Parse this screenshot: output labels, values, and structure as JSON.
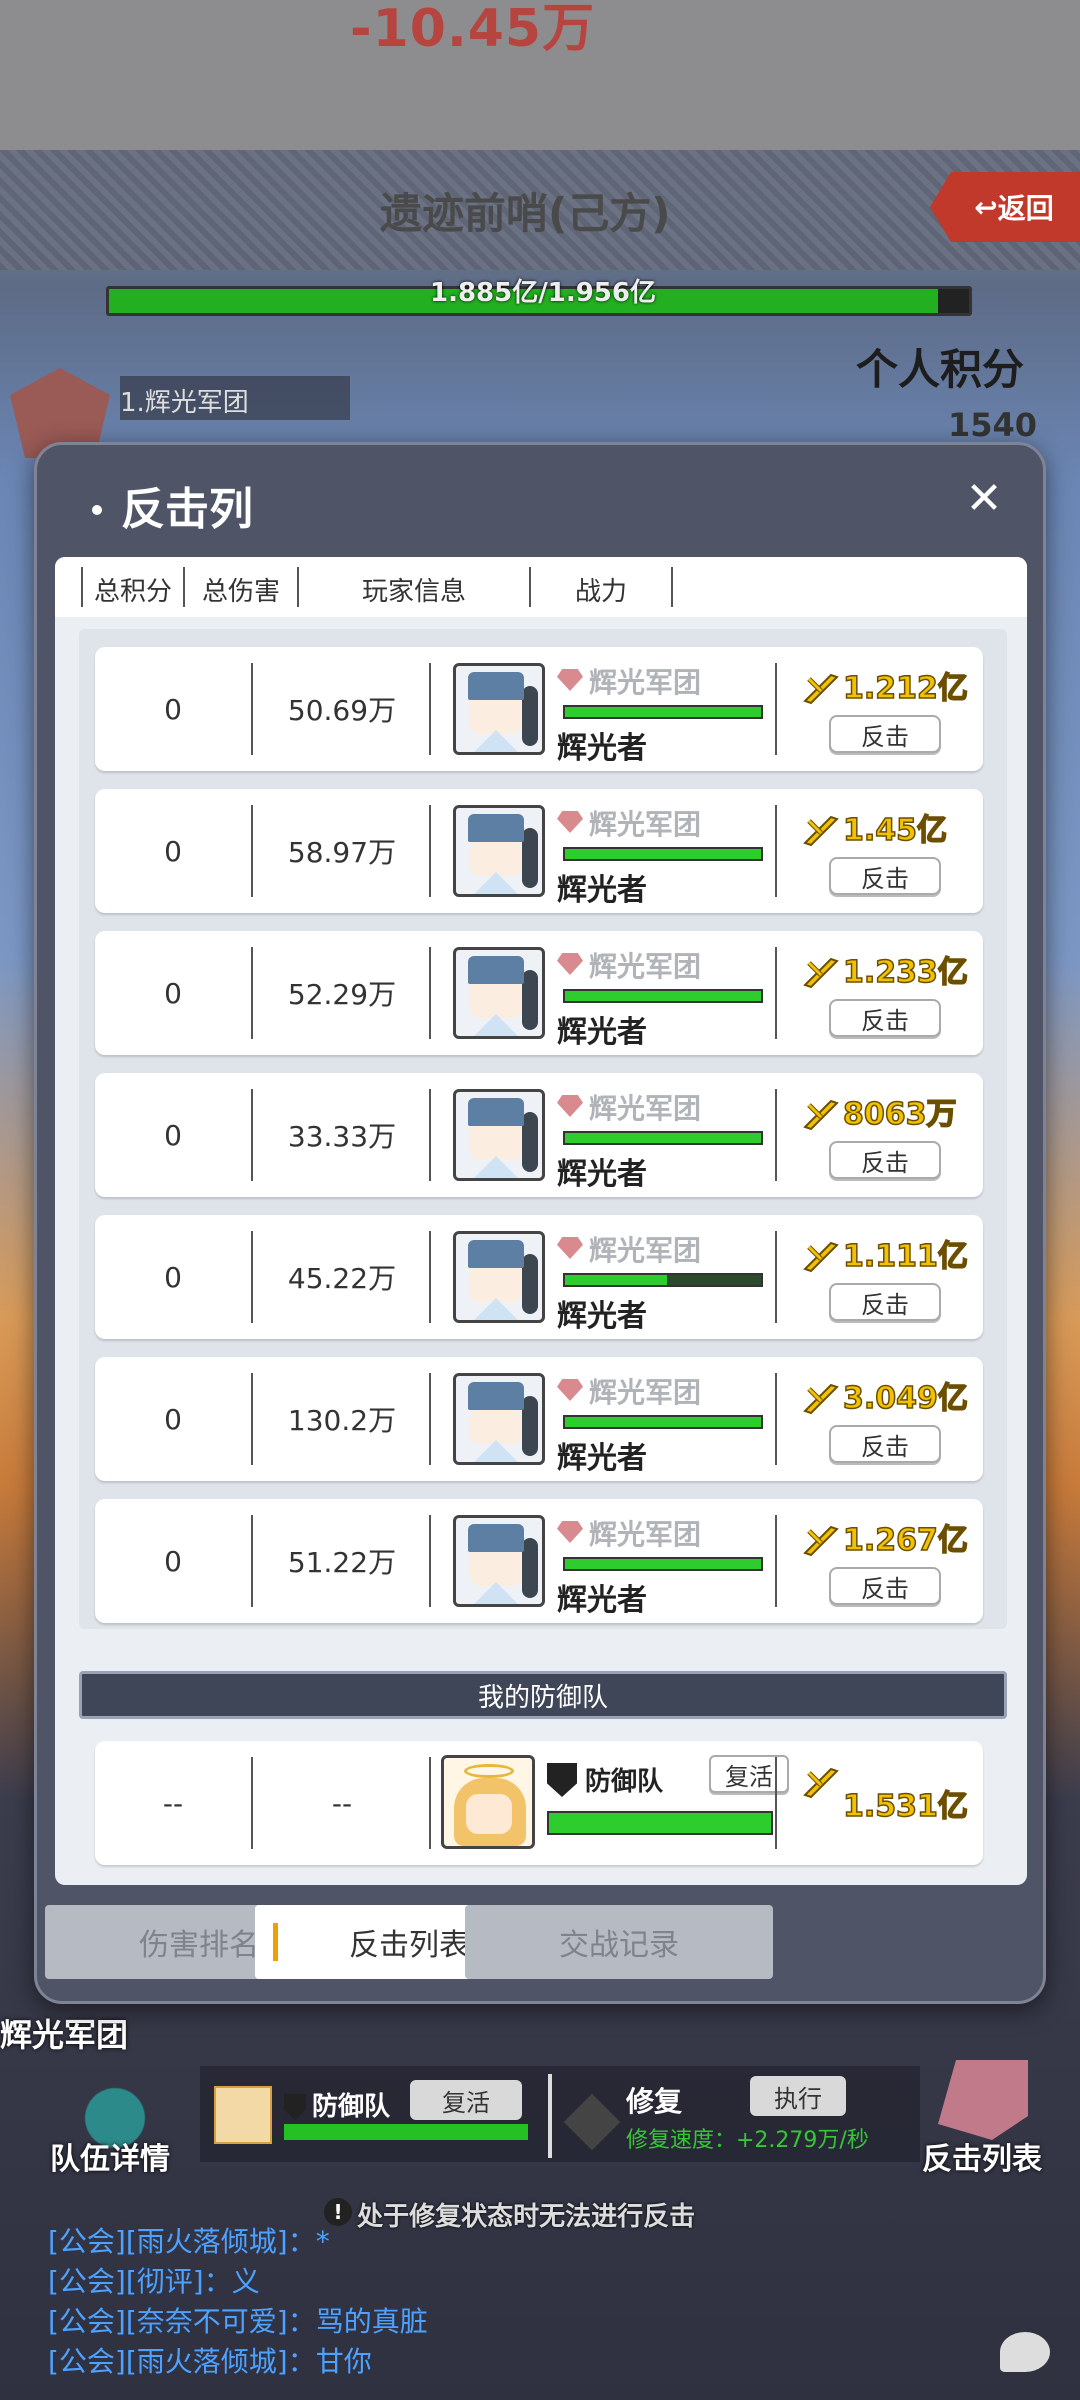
{
  "scene": {
    "damage_popup": "-10.45万",
    "stage_title": "遗迹前哨(己方)",
    "back_label": "返回",
    "hp_text": "1.885亿/1.956亿",
    "hp_fraction": 0.964,
    "guild_rank": "1.辉光军团",
    "personal_score_label": "个人积分",
    "personal_score_value": "1540"
  },
  "modal": {
    "title": "反击列",
    "close_glyph": "✕",
    "columns": [
      "总积分",
      "总伤害",
      "玩家信息",
      "战力"
    ],
    "rows": [
      {
        "score": "0",
        "damage": "50.69万",
        "guild": "辉光军团",
        "name": "辉光者",
        "power": "1.212亿",
        "hp": 1.0,
        "action": "反击"
      },
      {
        "score": "0",
        "damage": "58.97万",
        "guild": "辉光军团",
        "name": "辉光者",
        "power": "1.45亿",
        "hp": 1.0,
        "action": "反击"
      },
      {
        "score": "0",
        "damage": "52.29万",
        "guild": "辉光军团",
        "name": "辉光者",
        "power": "1.233亿",
        "hp": 1.0,
        "action": "反击"
      },
      {
        "score": "0",
        "damage": "33.33万",
        "guild": "辉光军团",
        "name": "辉光者",
        "power": "8063万",
        "hp": 1.0,
        "action": "反击"
      },
      {
        "score": "0",
        "damage": "45.22万",
        "guild": "辉光军团",
        "name": "辉光者",
        "power": "1.111亿",
        "hp": 0.52,
        "action": "反击"
      },
      {
        "score": "0",
        "damage": "130.2万",
        "guild": "辉光军团",
        "name": "辉光者",
        "power": "3.049亿",
        "hp": 1.0,
        "action": "反击"
      },
      {
        "score": "0",
        "damage": "51.22万",
        "guild": "辉光军团",
        "name": "辉光者",
        "power": "1.267亿",
        "hp": 1.0,
        "action": "反击"
      }
    ],
    "my_defense": {
      "banner": "我的防御队",
      "score": "--",
      "damage": "--",
      "name": "防御队",
      "revive": "复活",
      "power": "1.531亿",
      "hp": 1.0
    },
    "tabs": [
      {
        "label": "伤害排名",
        "active": false
      },
      {
        "label": "反击列表",
        "active": true
      },
      {
        "label": "交战记录",
        "active": false
      }
    ]
  },
  "hud": {
    "guild_label": "辉光军团",
    "team_detail": "队伍详情",
    "defense_name": "防御队",
    "revive": "复活",
    "repair": "修复",
    "execute": "执行",
    "repair_speed": "修复速度：+2.279万/秒",
    "counter_list": "反击列表",
    "warning": "处于修复状态时无法进行反击"
  },
  "chat": [
    "[公会][雨火落倾城]：*",
    "[公会][彻评]：义",
    "[公会][奈奈不可爱]：骂的真脏",
    "[公会][雨火落倾城]：甘你"
  ],
  "colors": {
    "power_gold": "#f2c200",
    "hp_green": "#2ccd2c",
    "chat_blue": "#4da1ff",
    "back_red": "#c0392b"
  }
}
